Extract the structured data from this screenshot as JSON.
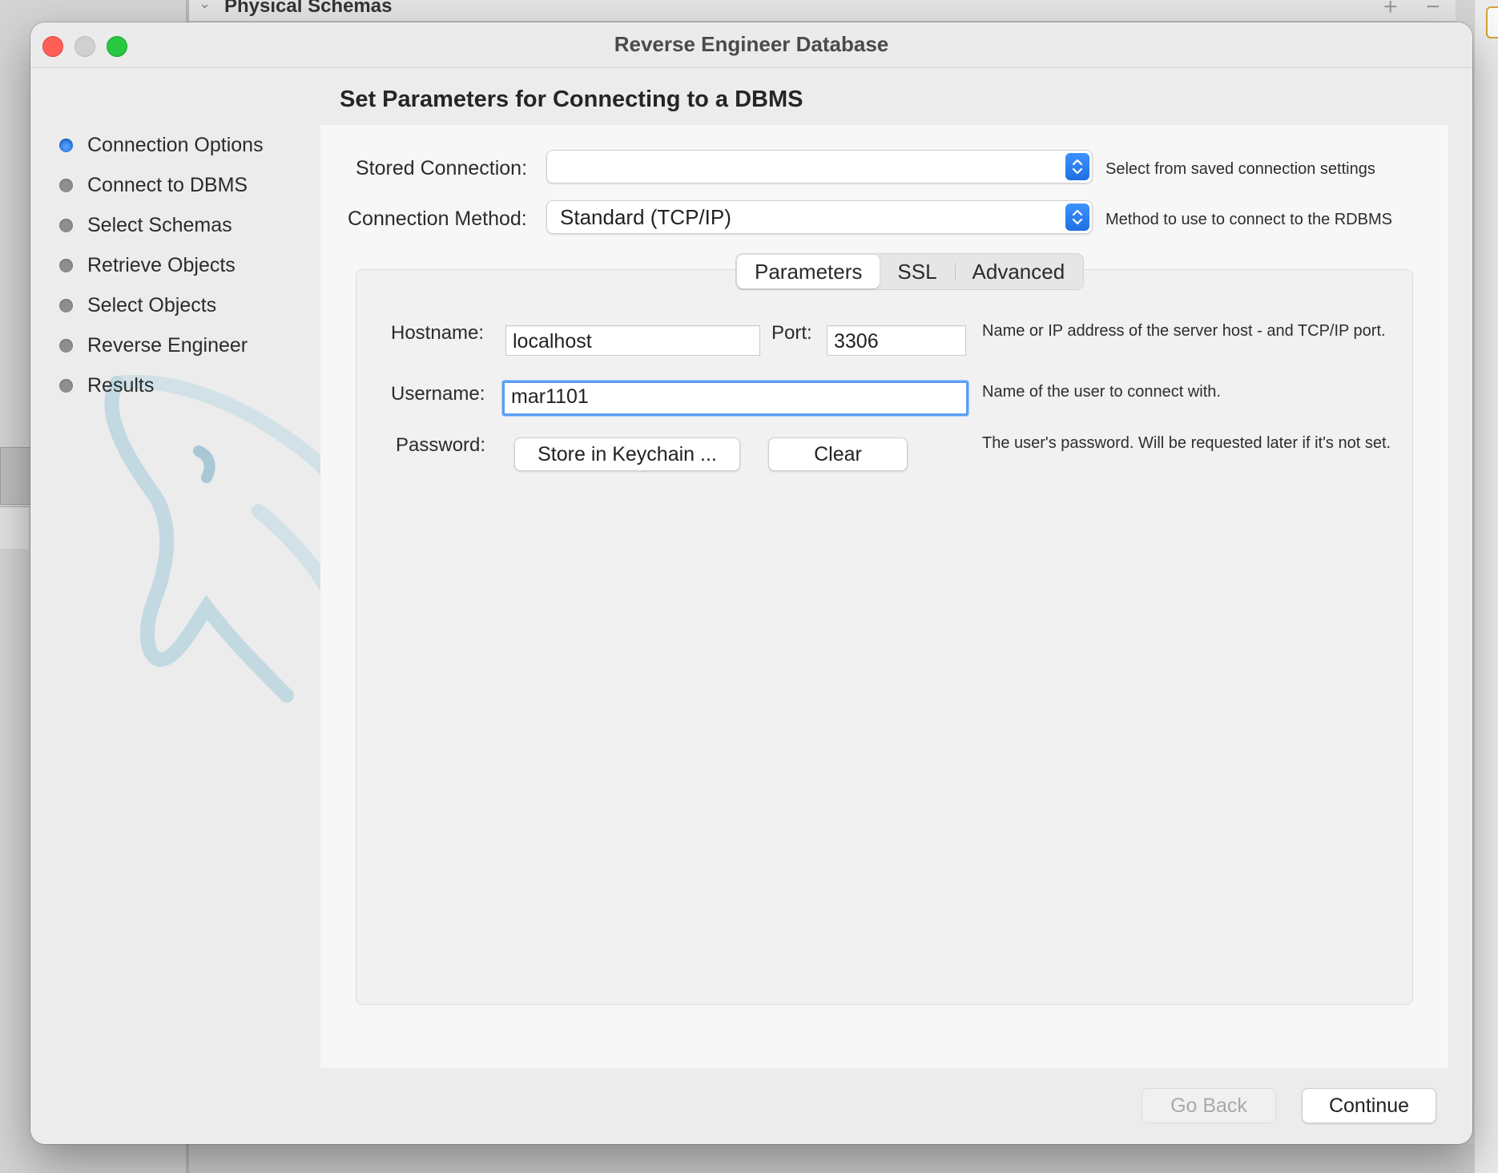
{
  "background": {
    "panel_title": "Physical Schemas",
    "add_label": "+",
    "remove_label": "−"
  },
  "window": {
    "title": "Reverse Engineer Database"
  },
  "steps": [
    {
      "label": "Connection Options",
      "active": true
    },
    {
      "label": "Connect to DBMS",
      "active": false
    },
    {
      "label": "Select Schemas",
      "active": false
    },
    {
      "label": "Retrieve Objects",
      "active": false
    },
    {
      "label": "Select Objects",
      "active": false
    },
    {
      "label": "Reverse Engineer",
      "active": false
    },
    {
      "label": "Results",
      "active": false
    }
  ],
  "page": {
    "heading": "Set Parameters for Connecting to a DBMS"
  },
  "stored_connection": {
    "label": "Stored Connection:",
    "value": "",
    "hint": "Select from saved connection settings"
  },
  "connection_method": {
    "label": "Connection Method:",
    "value": "Standard (TCP/IP)",
    "hint": "Method to use to connect to the RDBMS"
  },
  "tabs": [
    {
      "label": "Parameters",
      "selected": true
    },
    {
      "label": "SSL",
      "selected": false
    },
    {
      "label": "Advanced",
      "selected": false
    }
  ],
  "params": {
    "hostname_label": "Hostname:",
    "hostname_value": "localhost",
    "port_label": "Port:",
    "port_value": "3306",
    "host_hint": "Name or IP address of the server host - and TCP/IP port.",
    "username_label": "Username:",
    "username_value": "mar1101",
    "username_hint": "Name of the user to connect with.",
    "password_label": "Password:",
    "store_button": "Store in Keychain ...",
    "clear_button": "Clear",
    "password_hint": "The user's password. Will be requested later if it's not set."
  },
  "footer": {
    "back_button": "Go Back",
    "continue_button": "Continue"
  },
  "colors": {
    "accent": "#1f6fe0",
    "focus_ring": "#5b9df5",
    "close": "#ff5f57",
    "zoom": "#28c840"
  }
}
